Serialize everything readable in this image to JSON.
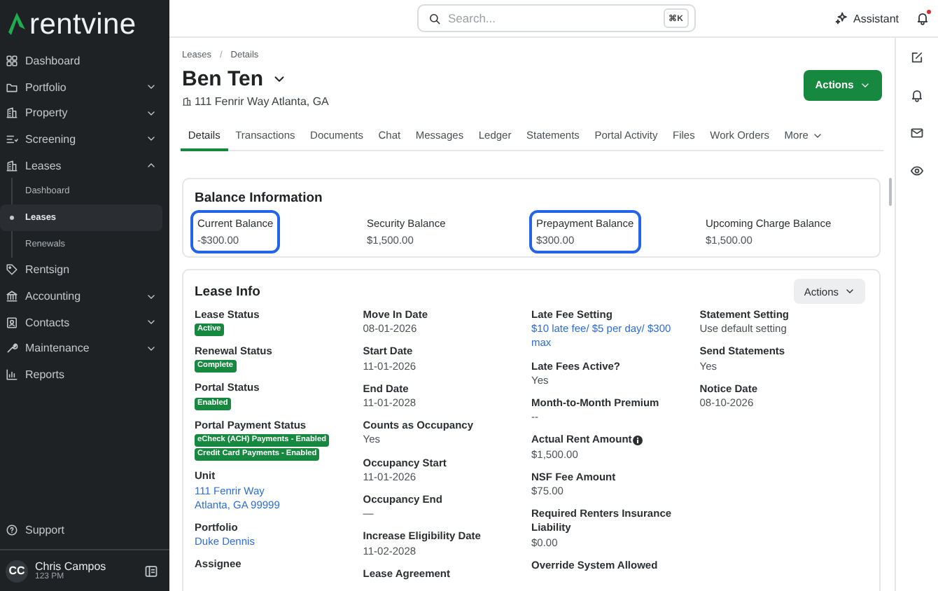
{
  "sidebar": {
    "logo": "rentvine",
    "items": [
      {
        "label": "Dashboard",
        "selected": false
      },
      {
        "label": "Portfolio",
        "expanded": false,
        "selected": false
      },
      {
        "label": "Property",
        "expanded": false,
        "selected": false
      },
      {
        "label": "Screening",
        "expanded": false,
        "selected": false
      },
      {
        "label": "Leases",
        "expanded": true,
        "selected": false,
        "children": [
          {
            "label": "Dashboard",
            "selected": false
          },
          {
            "label": "Leases",
            "selected": true
          },
          {
            "label": "Renewals",
            "selected": false
          }
        ]
      },
      {
        "label": "Rentsign",
        "selected": false
      },
      {
        "label": "Accounting",
        "expanded": false,
        "selected": false
      },
      {
        "label": "Contacts",
        "expanded": false,
        "selected": false
      },
      {
        "label": "Maintenance",
        "expanded": false,
        "selected": false
      },
      {
        "label": "Reports",
        "selected": false
      }
    ],
    "support": "Support",
    "user": {
      "initials": "CC",
      "name": "Chris Campos",
      "subtitle": "123 PM"
    }
  },
  "topbar": {
    "search": {
      "placeholder": "Search...",
      "shortcut": "⌘K"
    },
    "assistant": "Assistant",
    "notifications_unread": true
  },
  "header": {
    "breadcrumbs": [
      "Leases",
      "Details"
    ],
    "separator": "/",
    "title": "Ben Ten",
    "address": "111 Fenrir Way Atlanta, GA",
    "actions": "Actions"
  },
  "tabs": [
    {
      "label": "Details",
      "selected": true
    },
    {
      "label": "Transactions",
      "selected": false
    },
    {
      "label": "Documents",
      "selected": false
    },
    {
      "label": "Chat",
      "selected": false
    },
    {
      "label": "Messages",
      "selected": false
    },
    {
      "label": "Ledger",
      "selected": false
    },
    {
      "label": "Statements",
      "selected": false
    },
    {
      "label": "Portal Activity",
      "selected": false
    },
    {
      "label": "Files",
      "selected": false
    },
    {
      "label": "Work Orders",
      "selected": false
    },
    {
      "label": "More",
      "selected": false,
      "menu": true
    }
  ],
  "balance": {
    "title": "Balance Information",
    "items": [
      {
        "label": "Current Balance",
        "value": "-$300.00",
        "highlighted": true
      },
      {
        "label": "Security Balance",
        "value": "$1,500.00",
        "highlighted": false
      },
      {
        "label": "Prepayment Balance",
        "value": "$300.00",
        "highlighted": true
      },
      {
        "label": "Upcoming Charge Balance",
        "value": "$1,500.00",
        "highlighted": false
      }
    ]
  },
  "lease_info": {
    "title": "Lease Info",
    "actions": "Actions",
    "columns": [
      [
        {
          "kind": "badges",
          "label": "Lease Status",
          "badges": [
            "Active"
          ]
        },
        {
          "kind": "badges",
          "label": "Renewal Status",
          "badges": [
            "Complete"
          ]
        },
        {
          "kind": "badges",
          "label": "Portal Status",
          "badges": [
            "Enabled"
          ]
        },
        {
          "kind": "badges",
          "label": "Portal Payment Status",
          "badges": [
            "eCheck (ACH) Payments - Enabled",
            "Credit Card Payments - Enabled"
          ]
        },
        {
          "kind": "link",
          "label": "Unit",
          "value": "111 Fenrir Way\nAtlanta, GA 99999"
        },
        {
          "kind": "link",
          "label": "Portfolio",
          "value": "Duke Dennis"
        },
        {
          "kind": "text",
          "label": "Assignee"
        }
      ],
      [
        {
          "kind": "text",
          "label": "Move In Date",
          "value": "08-01-2026"
        },
        {
          "kind": "text",
          "label": "Start Date",
          "value": "11-01-2026"
        },
        {
          "kind": "text",
          "label": "End Date",
          "value": "11-01-2028"
        },
        {
          "kind": "text",
          "label": "Counts as Occupancy",
          "value": "Yes"
        },
        {
          "kind": "text",
          "label": "Occupancy Start",
          "value": "11-01-2026"
        },
        {
          "kind": "text",
          "label": "Occupancy End",
          "value": "—"
        },
        {
          "kind": "text",
          "label": "Increase Eligibility Date",
          "value": "11-02-2028"
        },
        {
          "kind": "text",
          "label": "Lease Agreement"
        }
      ],
      [
        {
          "kind": "link",
          "label": "Late Fee Setting",
          "value": "$10 late fee/ $5 per day/ $300 max"
        },
        {
          "kind": "text",
          "label": "Late Fees Active?",
          "value": "Yes"
        },
        {
          "kind": "text",
          "label": "Month-to-Month Premium",
          "value": "--"
        },
        {
          "kind": "text",
          "label": "Actual Rent Amount",
          "value": "$1,500.00",
          "info": true
        },
        {
          "kind": "text",
          "label": "NSF Fee Amount",
          "value": "$75.00"
        },
        {
          "kind": "text",
          "label": "Required Renters Insurance Liability",
          "value": "$0.00"
        },
        {
          "kind": "text",
          "label": "Override System Allowed"
        }
      ],
      [
        {
          "kind": "text",
          "label": "Statement Setting",
          "value": "Use default setting"
        },
        {
          "kind": "text",
          "label": "Send Statements",
          "value": "Yes"
        },
        {
          "kind": "text",
          "label": "Notice Date",
          "value": "08-10-2026"
        }
      ]
    ]
  }
}
